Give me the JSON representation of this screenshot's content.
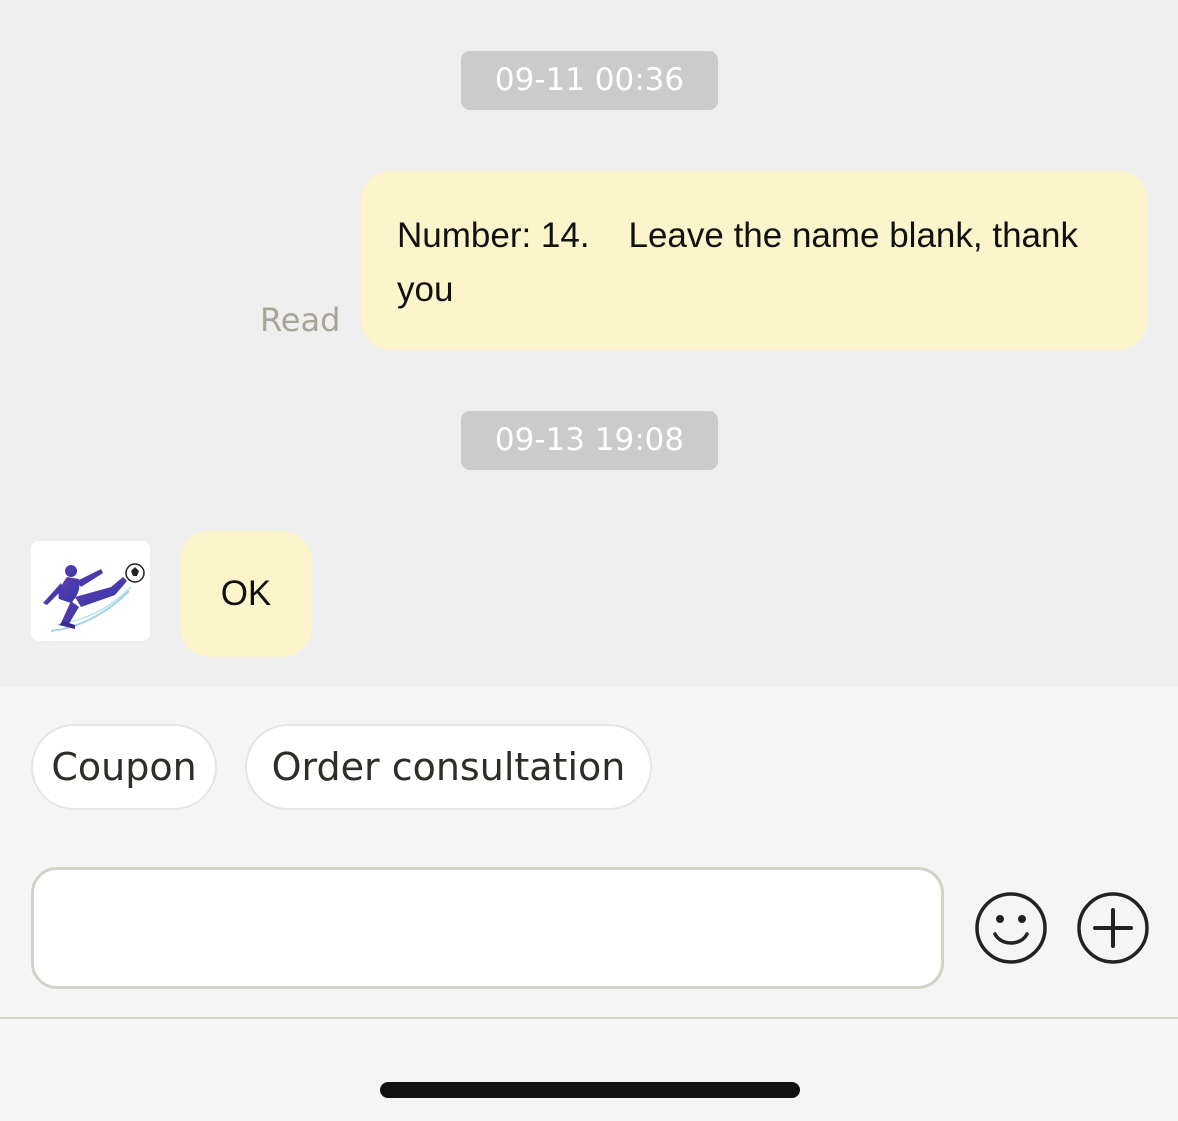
{
  "messages": {
    "timestamp_1": "09-11 00:36",
    "outgoing_text": "Number: 14.    Leave the name blank, thank you",
    "read_status": "Read",
    "timestamp_2": "09-13 19:08",
    "incoming_text": "OK"
  },
  "quick_replies": {
    "coupon_label": "Coupon",
    "order_label": "Order consultation"
  },
  "composer": {
    "input_value": "",
    "emoji_icon": "smiley-face-icon",
    "plus_icon": "plus-circle-icon"
  },
  "colors": {
    "bubble": "#fcf4cb",
    "background": "#efefef",
    "timestamp_bg": "#cbcbcb"
  }
}
